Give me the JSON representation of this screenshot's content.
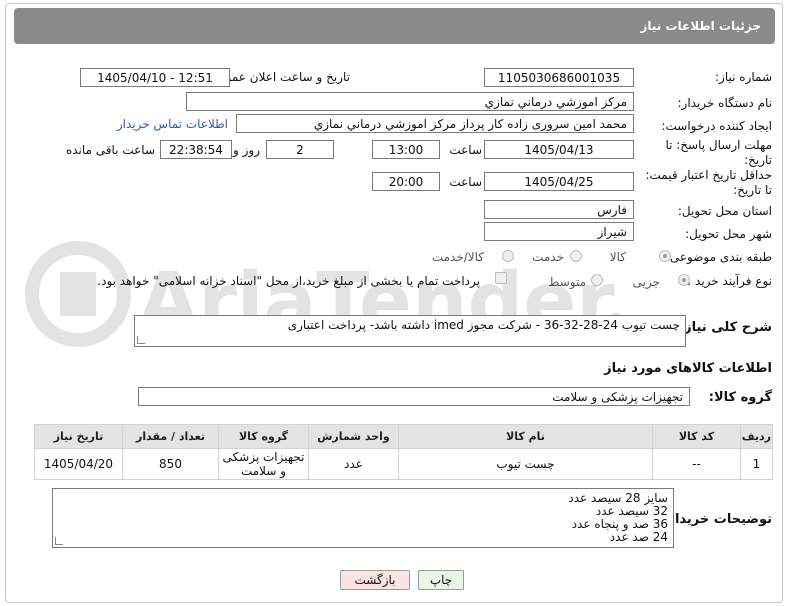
{
  "header": {
    "title": "جزئیات اطلاعات نیاز"
  },
  "watermark": {
    "text": "AriaTender.net"
  },
  "fields": {
    "need_number": {
      "label": "شماره نیاز:",
      "value": "1105030686001035"
    },
    "announce_datetime": {
      "label": "تاریخ و ساعت اعلان عمومی:",
      "value": "1405/04/10 - 12:51"
    },
    "buyer_org": {
      "label": "نام دستگاه خریدار:",
      "value": "مرکز اموزشي درماني نمازي"
    },
    "requester": {
      "label": "ایجاد کننده درخواست:",
      "value": "محمد امین سروری زاده کار پرداز مرکز اموزشي درماني نمازي",
      "contact_link": "اطلاعات تماس خریدار"
    },
    "reply_deadline": {
      "label_line1": "مهلت ارسال پاسخ: تا",
      "label_line2": "تاریخ:",
      "date": "1405/04/13",
      "time_label": "ساعت",
      "time": "13:00",
      "days": "2",
      "days_label": "روز و",
      "remaining": "22:38:54",
      "remaining_label": "ساعت باقی مانده"
    },
    "price_validity": {
      "label_line1": "حداقل تاریخ اعتبار قیمت:",
      "label_line2": "تا تاریخ:",
      "date": "1405/04/25",
      "time_label": "ساعت",
      "time": "20:00"
    },
    "delivery_province": {
      "label": "استان محل تحویل:",
      "value": "فارس"
    },
    "delivery_city": {
      "label": "شهر محل تحویل:",
      "value": "شیراز"
    },
    "category": {
      "label": "طبقه بندی موضوعی:",
      "options": [
        "کالا",
        "خدمت",
        "کالا/خدمت"
      ],
      "selected": "کالا"
    },
    "purchase_type": {
      "label": "نوع فرآیند خرید :",
      "options": [
        "جزیی",
        "متوسط"
      ],
      "selected": "جزیی",
      "payment_note": "پرداخت تمام یا بخشی از مبلغ خرید،از محل \"اسناد خزانه اسلامی\" خواهد بود."
    }
  },
  "description": {
    "label": "شرح کلی نیاز:",
    "value": "چست تیوب 24-28-32-36  - شرکت مجوز imed داشته باشد- پرداخت اعتباری"
  },
  "goods_section": {
    "title": "اطلاعات کالاهای مورد نیاز"
  },
  "goods_group": {
    "label": "گروه کالا:",
    "value": "تجهیزات پزشکی و سلامت"
  },
  "table": {
    "headers": [
      "ردیف",
      "کد کالا",
      "نام کالا",
      "واحد شمارش",
      "گروه کالا",
      "تعداد / مقدار",
      "تاریخ نیاز"
    ],
    "rows": [
      [
        "1",
        "--",
        "چست تیوب",
        "عدد",
        "تجهیزات پزشکی و سلامت",
        "850",
        "1405/04/20"
      ]
    ]
  },
  "buyer_notes": {
    "label": "توضیحات خریدار:",
    "lines": [
      "سایز 28 سیصد عدد",
      "32 سیصد عدد",
      "36 صد و پنجاه عدد",
      "24 صد عدد"
    ]
  },
  "buttons": {
    "print": "چاپ",
    "back": "بازگشت"
  },
  "colors": {
    "header_bg": "#8a8a8a",
    "link": "#2a5db0",
    "print_btn": "#eaf7e6",
    "back_btn": "#fbe3e3"
  }
}
